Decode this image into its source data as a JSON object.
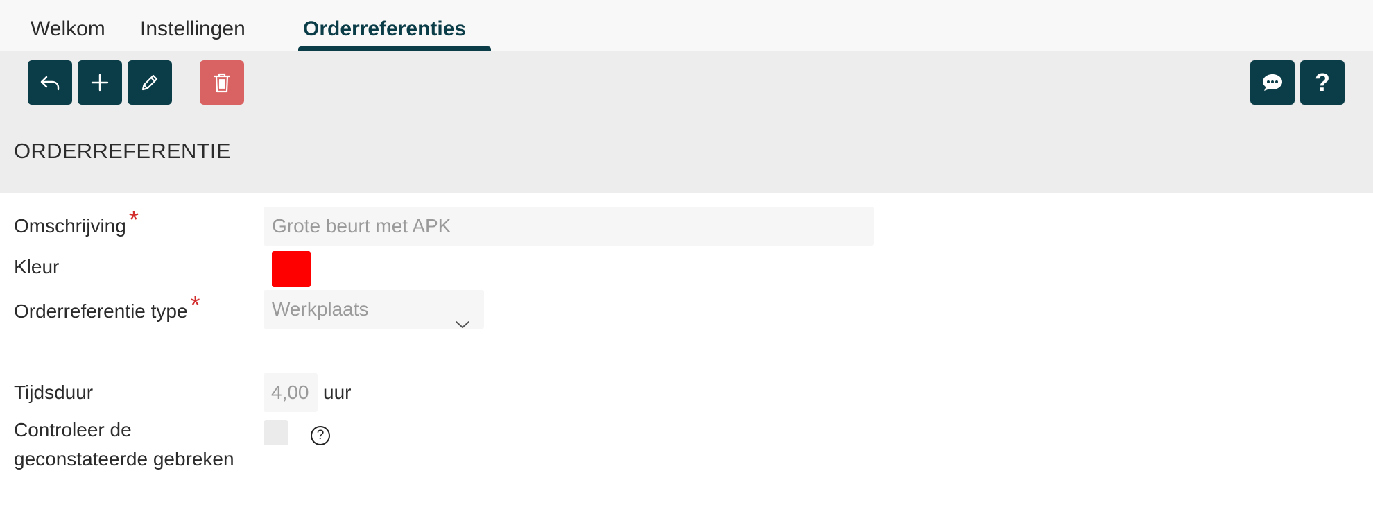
{
  "tabs": [
    {
      "label": "Welkom"
    },
    {
      "label": "Instellingen"
    },
    {
      "label": "Orderreferenties",
      "active": true
    }
  ],
  "toolbar": {
    "buttons": [
      {
        "name": "back-button",
        "icon": "undo-arrow-icon"
      },
      {
        "name": "add-button",
        "icon": "plus-icon"
      },
      {
        "name": "edit-button",
        "icon": "pencil-icon"
      },
      {
        "name": "delete-button",
        "icon": "trash-icon"
      },
      {
        "name": "chat-button",
        "icon": "chat-bubble-icon"
      },
      {
        "name": "help-button",
        "icon": "question-icon",
        "glyph": "?"
      }
    ]
  },
  "page": {
    "title": "ORDERREFERENTIE"
  },
  "form": {
    "omschrijving": {
      "label": "Omschrijving",
      "required_mark": "*",
      "value": "Grote beurt met APK"
    },
    "kleur": {
      "label": "Kleur",
      "value": "#ff0000"
    },
    "type": {
      "label": "Orderreferentie type",
      "required_mark": "*",
      "value": "Werkplaats"
    },
    "tijdsduur": {
      "label": "Tijdsduur",
      "value": "4,00",
      "unit": "uur"
    },
    "controleer": {
      "label_line1": "Controleer de",
      "label_line2": "geconstateerde gebreken",
      "checked": false,
      "help_glyph": "?"
    }
  },
  "colors": {
    "primary": "#0b3d48",
    "danger": "#d96262",
    "required": "#d22c2c",
    "header_bg": "#ededed",
    "tabbar_bg": "#f8f8f8"
  }
}
